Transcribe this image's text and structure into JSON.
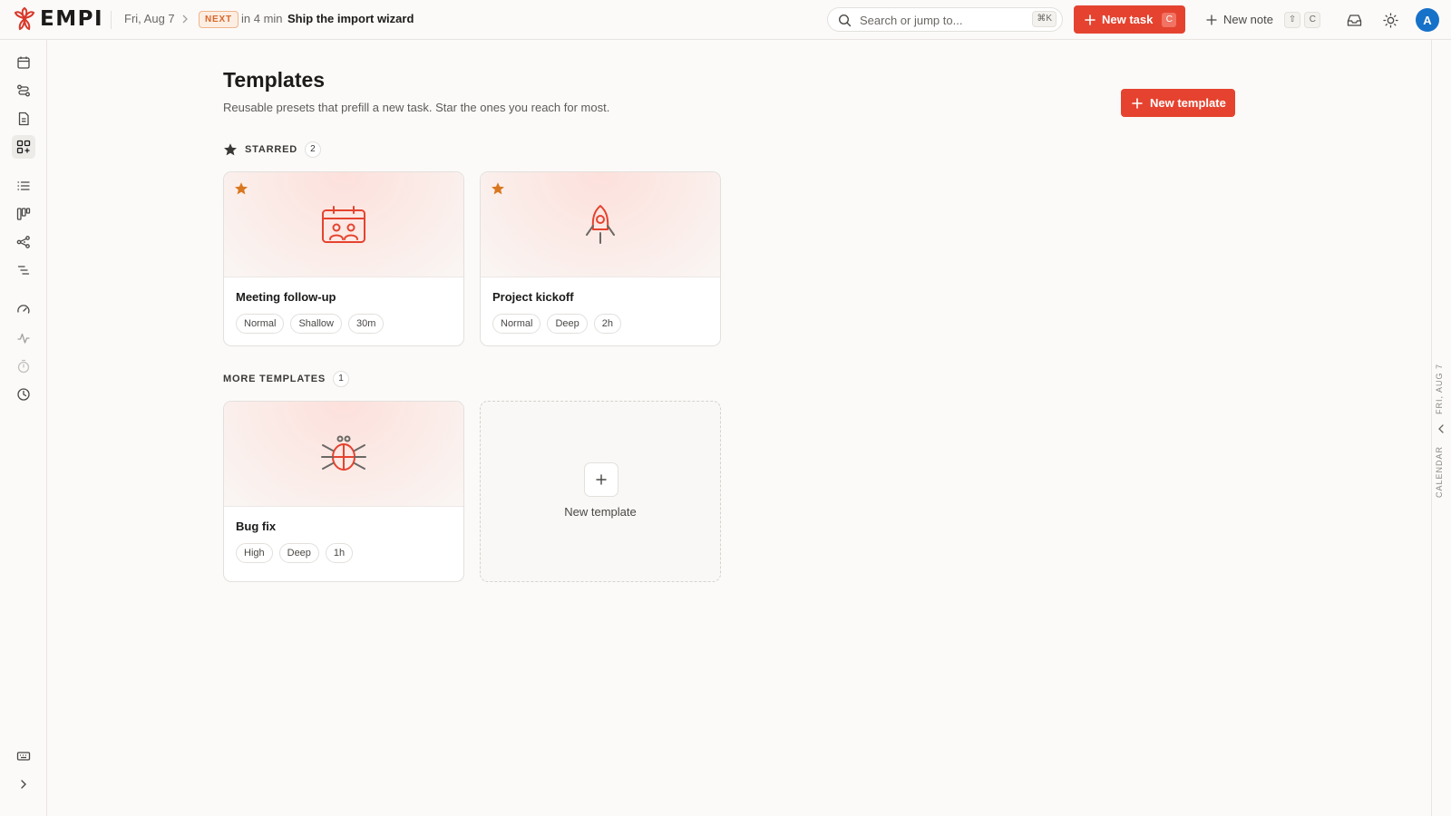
{
  "app": {
    "name": "EMPI"
  },
  "topbar": {
    "date": "Fri, Aug 7",
    "next_badge": "NEXT",
    "next_in": "in 4 min",
    "next_title": "Ship the import wizard",
    "search_placeholder": "Search or jump to...",
    "search_shortcut": "⌘K",
    "new_task_label": "New task",
    "new_task_shortcut": "C",
    "new_note_label": "New note",
    "new_note_shortcut_1": "⇧",
    "new_note_shortcut_2": "C",
    "avatar_initial": "A",
    "icons": [
      "inbox-icon",
      "sun-icon"
    ]
  },
  "sidebar": {
    "items": [
      {
        "name": "calendar-icon"
      },
      {
        "name": "flow-icon"
      },
      {
        "name": "notes-icon"
      },
      {
        "name": "templates-icon",
        "active": true
      },
      {
        "name": "list-icon"
      },
      {
        "name": "board-icon"
      },
      {
        "name": "graph-icon"
      },
      {
        "name": "outline-icon"
      },
      {
        "name": "review-icon"
      },
      {
        "name": "activity-icon"
      },
      {
        "name": "timer-icon"
      },
      {
        "name": "history-icon"
      },
      {
        "name": "keyboard-icon"
      },
      {
        "name": "expand-icon"
      }
    ]
  },
  "rail": {
    "date": "FRI, AUG 7",
    "label": "CALENDAR"
  },
  "page": {
    "title": "Templates",
    "subtitle": "Reusable presets that prefill a new task. Star the ones you reach for most.",
    "new_template_label": "New template"
  },
  "sections": {
    "starred": {
      "label": "STARRED",
      "count": "2"
    },
    "more": {
      "label": "MORE TEMPLATES",
      "count": "1"
    }
  },
  "templates": [
    {
      "title": "Meeting follow-up",
      "icon": "calendar-people-icon",
      "starred": true,
      "chips": [
        "Normal",
        "Shallow",
        "30m"
      ]
    },
    {
      "title": "Project kickoff",
      "icon": "rocket-icon",
      "starred": true,
      "chips": [
        "Normal",
        "Deep",
        "2h"
      ]
    },
    {
      "title": "Bug fix",
      "icon": "bug-icon",
      "starred": false,
      "chips": [
        "High",
        "Deep",
        "1h"
      ]
    }
  ],
  "new_template_card": {
    "label": "New template"
  },
  "colors": {
    "accent": "#e5432f",
    "star": "#d9771f",
    "avatar": "#1671c8"
  }
}
